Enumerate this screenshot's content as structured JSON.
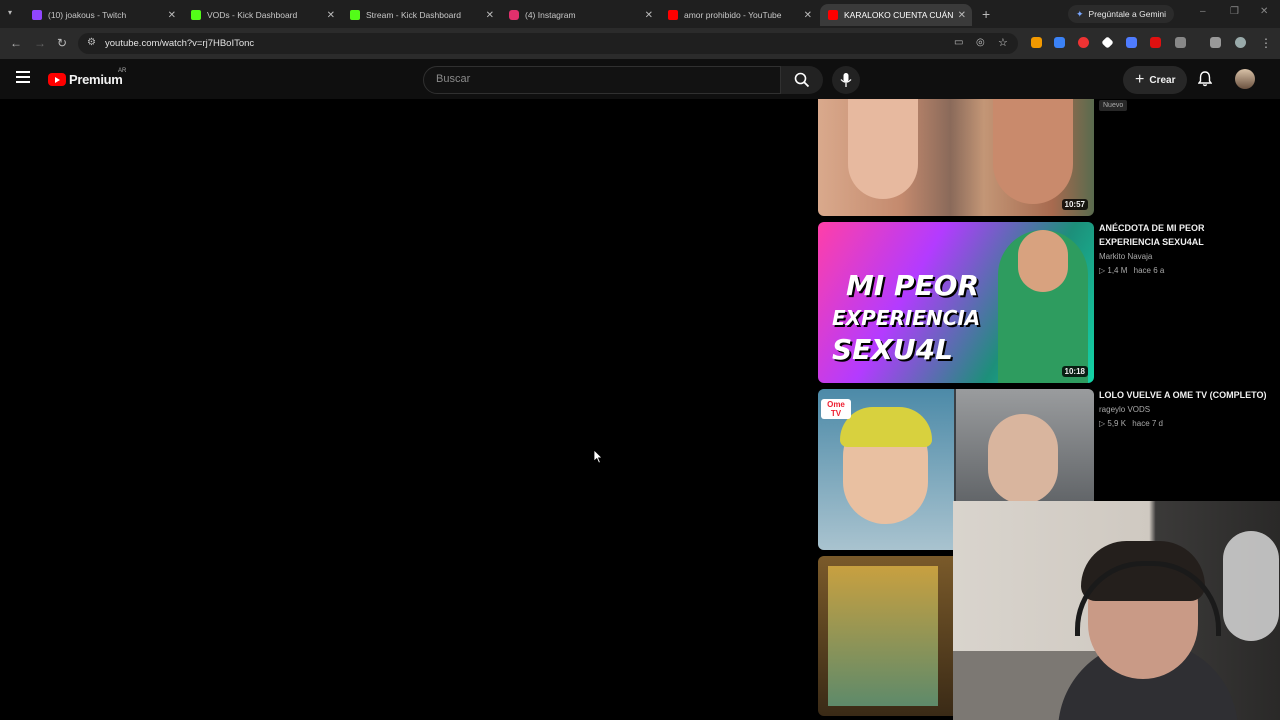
{
  "browser": {
    "tabs": [
      {
        "title": "(10) joakous - Twitch",
        "icon": "twitch-icon",
        "color": "#9146ff"
      },
      {
        "title": "VODs - Kick Dashboard",
        "icon": "kick-icon",
        "color": "#53fc18"
      },
      {
        "title": "Stream - Kick Dashboard",
        "icon": "kick-icon",
        "color": "#53fc18"
      },
      {
        "title": "(4) Instagram",
        "icon": "instagram-icon",
        "color": "#e1306c"
      },
      {
        "title": "amor prohibido - YouTube",
        "icon": "youtube-icon",
        "color": "#ff0000"
      },
      {
        "title": "KARALOKO CUENTA CUÁNDO",
        "icon": "youtube-icon",
        "color": "#ff0000"
      }
    ],
    "gemini_label": "Pregúntale a Gemini",
    "url": "youtube.com/watch?v=rj7HBoITonc"
  },
  "youtube": {
    "logo_text": "Premium",
    "country": "AR",
    "search_placeholder": "Buscar",
    "create_label": "Crear",
    "accent": "#ff0000"
  },
  "videos": [
    {
      "badge": "Nuevo",
      "duration": "10:57"
    },
    {
      "title": "ANÉCDOTA DE MI PEOR EXPERIENCIA SEXU4AL",
      "channel": "Markito Navaja",
      "views": "1,4 M",
      "age": "hace 6 a",
      "duration": "10:18",
      "thumb_text_1": "MI PEOR",
      "thumb_text_2": "EXPERIENCIA",
      "thumb_text_3": "SEXU4L"
    },
    {
      "title": "LOLO VUELVE A OME TV (COMPLETO)",
      "channel": "rageylo VODS",
      "views": "5,9 K",
      "age": "hace 7 d",
      "thumb_badge": "Ome TV"
    },
    {}
  ]
}
